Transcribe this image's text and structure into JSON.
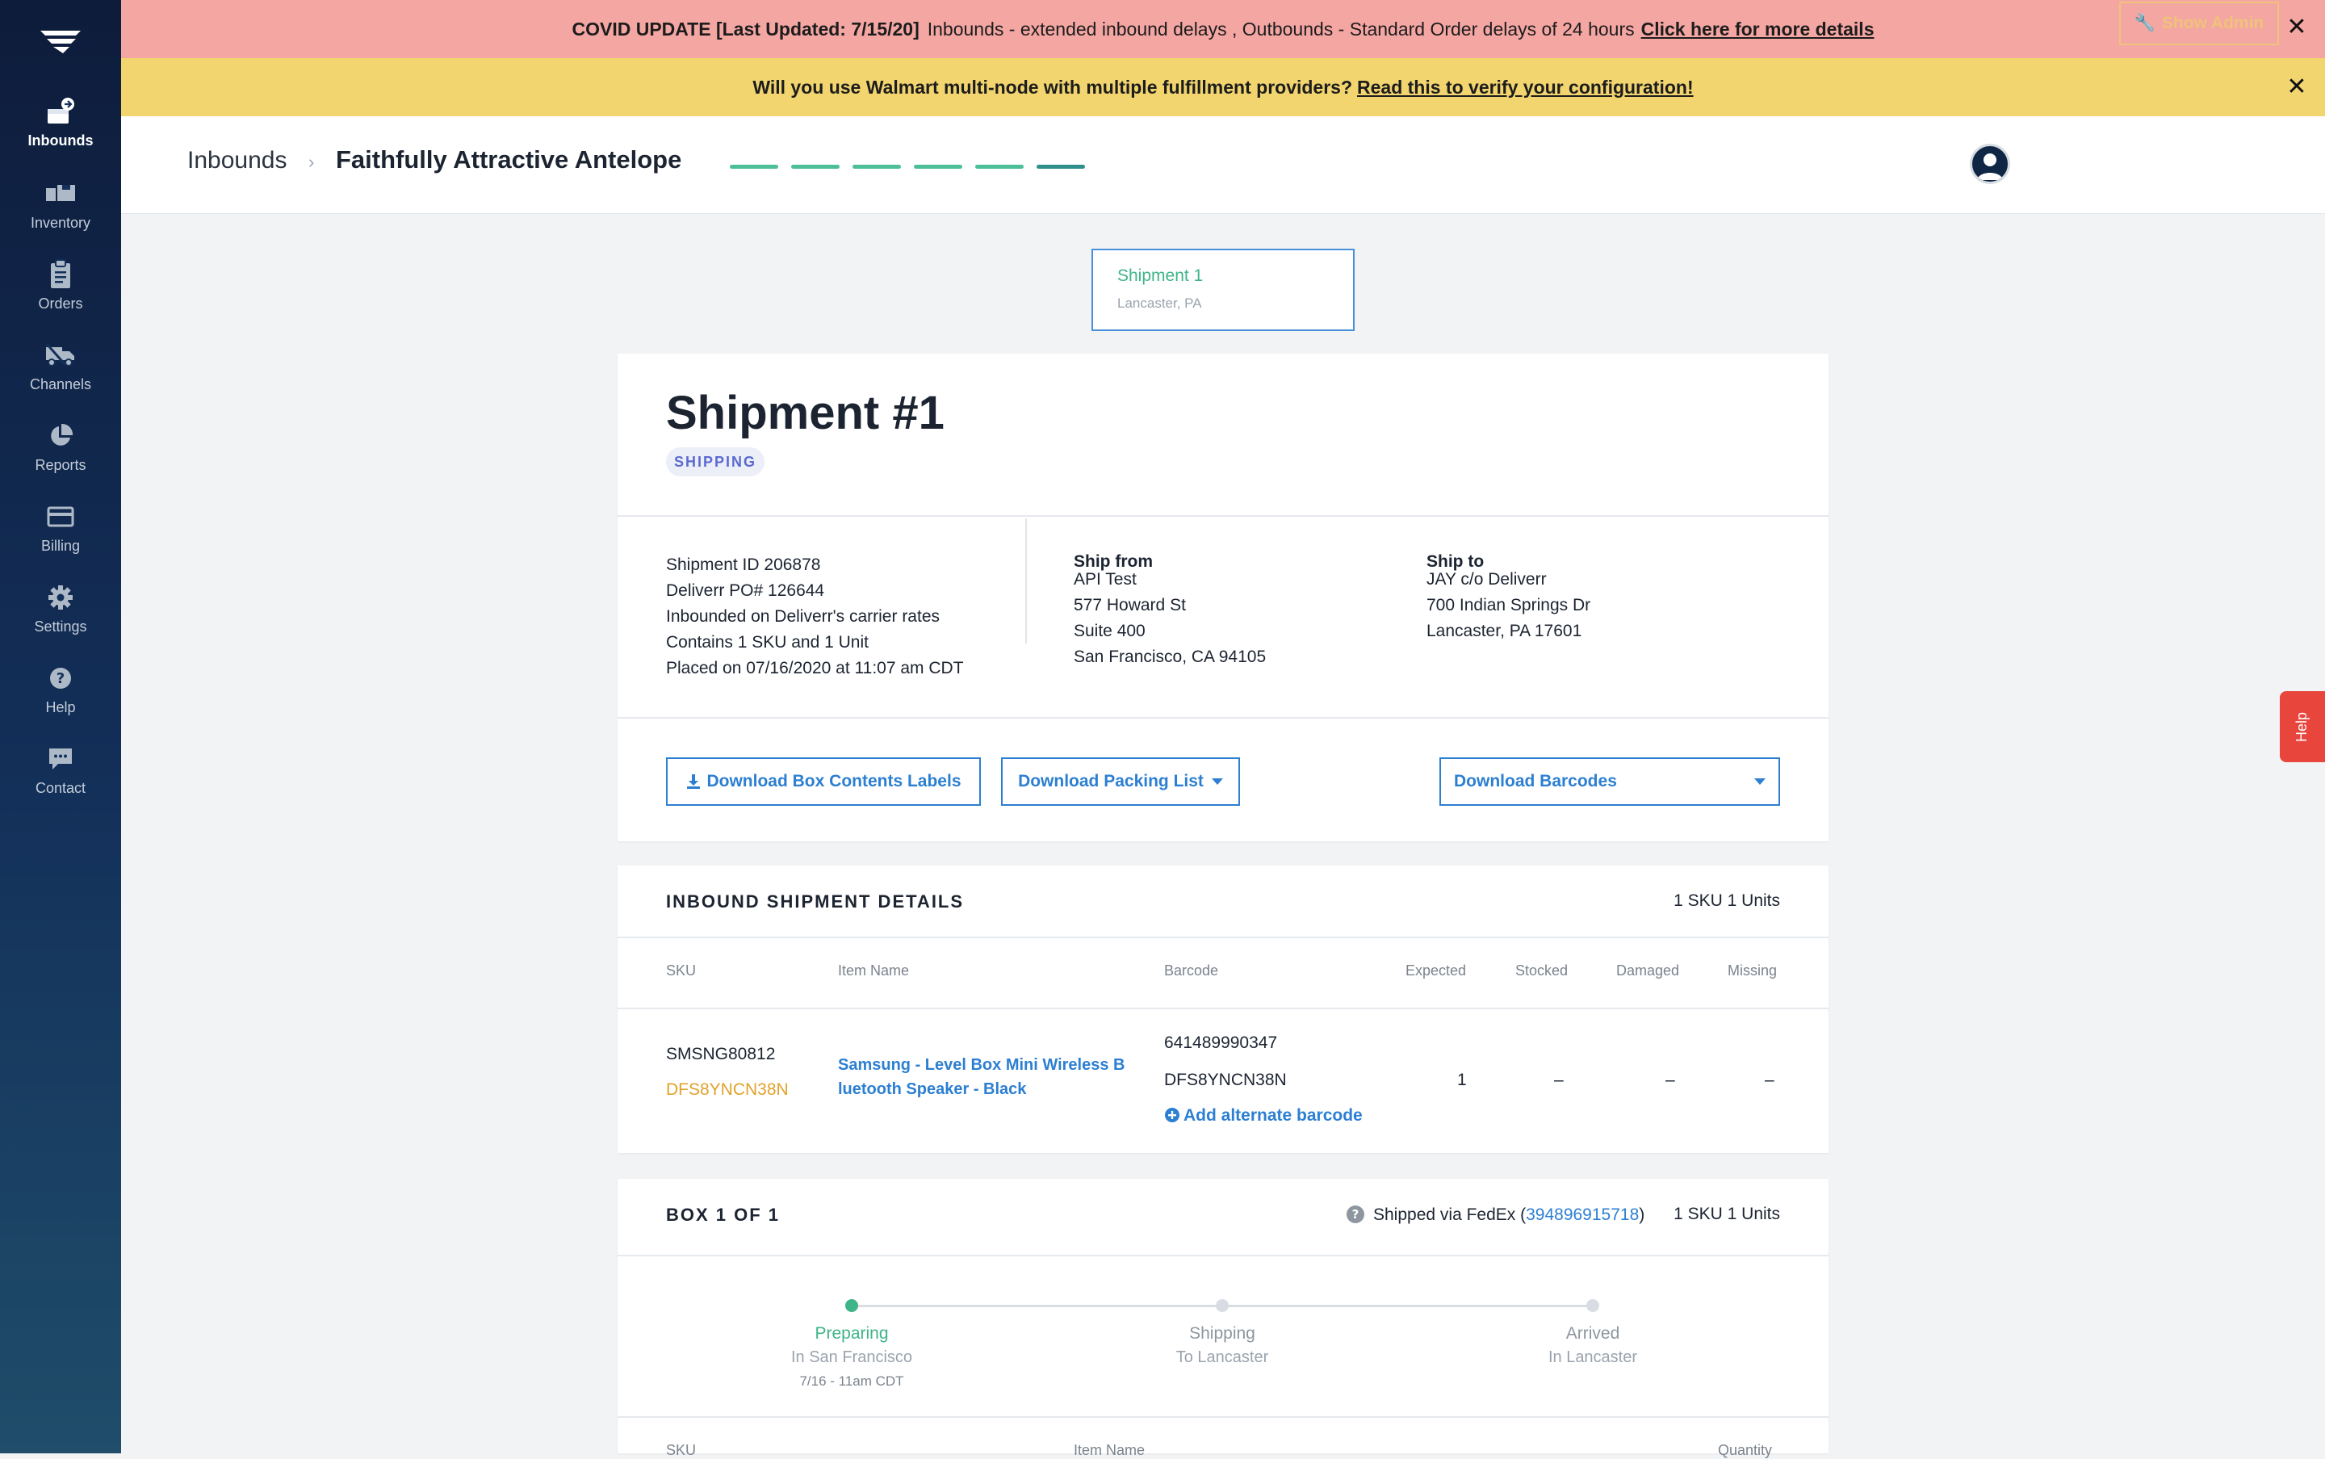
{
  "colors": {
    "sidebar_top": "#0e1c3b",
    "covid_banner": "#f4a6a3",
    "walmart_banner": "#f2d56f",
    "accent_green": "#3eb489",
    "link_blue": "#2c7fd1",
    "badge_purple": "#5b6ad0",
    "help_red": "#e8453c"
  },
  "sidebar": {
    "items": [
      {
        "label": "Inbounds",
        "icon": "inbound-box-icon"
      },
      {
        "label": "Inventory",
        "icon": "inventory-icon"
      },
      {
        "label": "Orders",
        "icon": "clipboard-icon"
      },
      {
        "label": "Channels",
        "icon": "channels-truck-icon"
      },
      {
        "label": "Reports",
        "icon": "pie-chart-icon"
      },
      {
        "label": "Billing",
        "icon": "credit-card-icon"
      },
      {
        "label": "Settings",
        "icon": "gear-icon"
      },
      {
        "label": "Help",
        "icon": "question-icon"
      },
      {
        "label": "Contact",
        "icon": "chat-icon"
      }
    ]
  },
  "covid_banner": {
    "title": "COVID UPDATE [Last Updated: 7/15/20]",
    "text": "Inbounds - extended inbound delays , Outbounds - Standard Order delays of 24 hours",
    "link": "Click here for more details",
    "show_admin": "Show Admin",
    "close": "✕"
  },
  "walmart_banner": {
    "text": "Will you use Walmart multi-node with multiple fulfillment providers?",
    "link": "Read this to verify your configuration!",
    "close": "✕"
  },
  "header": {
    "breadcrumb_root": "Inbounds",
    "separator": "›",
    "breadcrumb_current": "Faithfully Attractive Antelope"
  },
  "shipment_tab": {
    "label": "Shipment 1",
    "location": "Lancaster, PA"
  },
  "shipment": {
    "title": "Shipment #1",
    "status": "SHIPPING",
    "info": [
      "Shipment ID 206878",
      "Deliverr PO# 126644",
      "Inbounded on Deliverr's carrier rates",
      "Contains 1 SKU and 1 Unit",
      "Placed on 07/16/2020 at 11:07 am CDT"
    ],
    "ship_from": {
      "title": "Ship from",
      "lines": [
        "API Test",
        "577 Howard St",
        "Suite 400",
        "San Francisco, CA 94105"
      ]
    },
    "ship_to": {
      "title": "Ship to",
      "lines": [
        "JAY c/o Deliverr",
        "700 Indian Springs Dr",
        "Lancaster, PA 17601"
      ]
    },
    "buttons": {
      "box_labels": "Download Box Contents Labels",
      "packing_list": "Download Packing List",
      "barcodes": "Download Barcodes"
    }
  },
  "details": {
    "title": "INBOUND SHIPMENT DETAILS",
    "meta": "1 SKU 1 Units",
    "columns": [
      "SKU",
      "Item Name",
      "Barcode",
      "Expected",
      "Stocked",
      "Damaged",
      "Missing"
    ],
    "row": {
      "sku": "SMSNG80812",
      "dsku": "DFS8YNCN38N",
      "name_line1": "Samsung - Level Box Mini Wireless B",
      "name_line2": "luetooth Speaker - Black",
      "barcode1": "641489990347",
      "barcode2": "DFS8YNCN38N",
      "add_barcode": "Add alternate barcode",
      "expected": "1",
      "stocked": "–",
      "damaged": "–",
      "missing": "–"
    }
  },
  "box": {
    "title": "BOX 1 OF 1",
    "shipped_prefix": "Shipped via FedEx (",
    "tracking": "394896915718",
    "shipped_suffix": ")",
    "meta": "1 SKU 1 Units",
    "timeline": [
      {
        "label": "Preparing",
        "sub": "In San Francisco",
        "date": "7/16 - 11am CDT"
      },
      {
        "label": "Shipping",
        "sub": "To Lancaster",
        "date": ""
      },
      {
        "label": "Arrived",
        "sub": "In Lancaster",
        "date": ""
      }
    ],
    "columns": [
      "SKU",
      "Item Name",
      "Quantity"
    ]
  },
  "help_tab": "Help"
}
